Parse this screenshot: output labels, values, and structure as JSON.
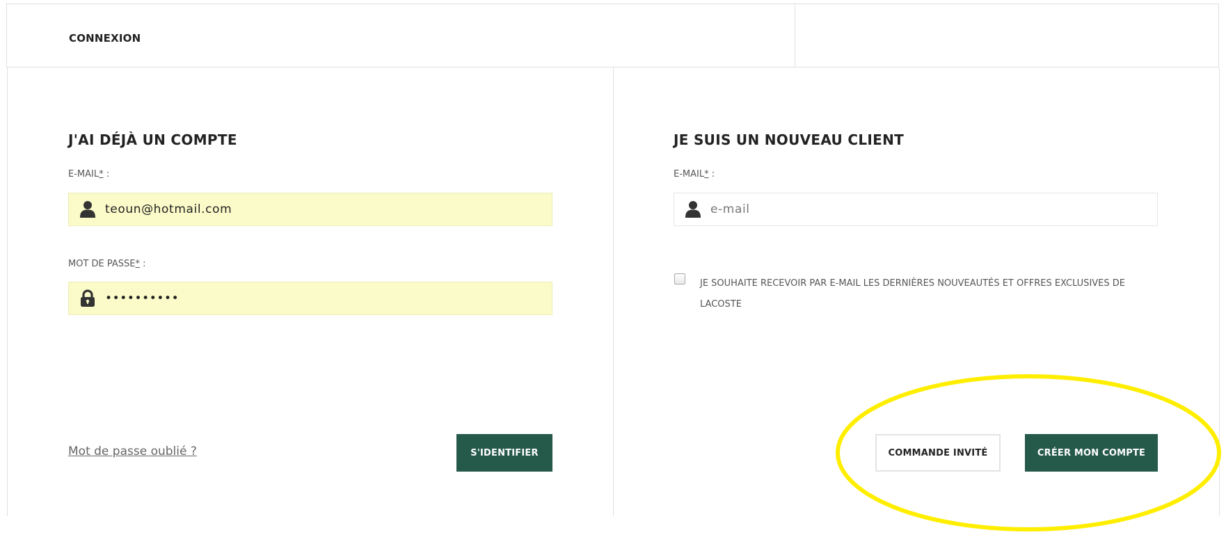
{
  "tabs": {
    "login_label": "CONNEXION"
  },
  "existing_account": {
    "title": "J'AI DÉJÀ UN COMPTE",
    "email_label": "E-MAIL",
    "email_required_mark": "*",
    "email_label_suffix": " :",
    "email_value": "teoun@hotmail.com",
    "password_label": "MOT DE PASSE",
    "password_required_mark": "*",
    "password_label_suffix": " :",
    "password_value": "••••••••••",
    "forgot_password_link": "Mot de passe oublié ?",
    "login_button": "S'IDENTIFIER"
  },
  "new_customer": {
    "title": "JE SUIS UN NOUVEAU CLIENT",
    "email_label": "E-MAIL",
    "email_required_mark": "*",
    "email_label_suffix": " :",
    "email_placeholder": "e-mail",
    "newsletter_text": "JE SOUHAITE RECEVOIR PAR E-MAIL LES DERNIÈRES NOUVEAUTÉS ET OFFRES EXCLUSIVES DE LACOSTE",
    "newsletter_checked": false,
    "guest_button": "COMMANDE INVITÉ",
    "create_account_button": "CRÉER MON COMPTE"
  },
  "icons": {
    "email_icon": "user-icon",
    "password_icon": "lock-icon"
  },
  "colors": {
    "primary_button": "#25594a",
    "autofill_background": "#fbfbc9",
    "highlight_annotation": "#ffee00",
    "border": "#e0e0e0"
  }
}
